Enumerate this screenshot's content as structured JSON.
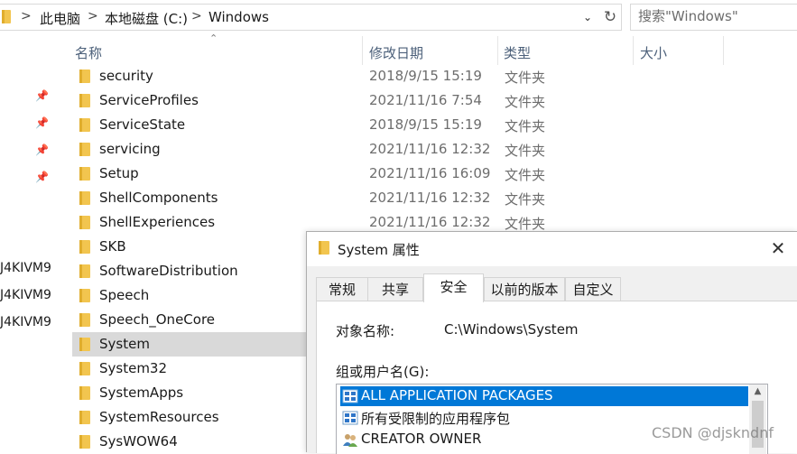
{
  "address": {
    "crumbs": [
      "此电脑",
      "本地磁盘 (C:)",
      "Windows"
    ],
    "separator": ">"
  },
  "search": {
    "placeholder": "搜索\"Windows\""
  },
  "columns": {
    "name": "名称",
    "date": "修改日期",
    "type": "类型",
    "size": "大小"
  },
  "nav": {
    "items": [
      "J4KIVM9",
      "J4KIVM9",
      "J4KIVM9"
    ]
  },
  "files": [
    {
      "name": "security",
      "date": "2018/9/15 15:19",
      "type": "文件夹"
    },
    {
      "name": "ServiceProfiles",
      "date": "2021/11/16 7:54",
      "type": "文件夹"
    },
    {
      "name": "ServiceState",
      "date": "2018/9/15 15:19",
      "type": "文件夹"
    },
    {
      "name": "servicing",
      "date": "2021/11/16 12:32",
      "type": "文件夹"
    },
    {
      "name": "Setup",
      "date": "2021/11/16 16:09",
      "type": "文件夹"
    },
    {
      "name": "ShellComponents",
      "date": "2021/11/16 12:32",
      "type": "文件夹"
    },
    {
      "name": "ShellExperiences",
      "date": "2021/11/16 12:32",
      "type": "文件夹"
    },
    {
      "name": "SKB",
      "date": "",
      "type": ""
    },
    {
      "name": "SoftwareDistribution",
      "date": "",
      "type": ""
    },
    {
      "name": "Speech",
      "date": "",
      "type": ""
    },
    {
      "name": "Speech_OneCore",
      "date": "",
      "type": ""
    },
    {
      "name": "System",
      "date": "",
      "type": "",
      "selected": true
    },
    {
      "name": "System32",
      "date": "",
      "type": ""
    },
    {
      "name": "SystemApps",
      "date": "",
      "type": ""
    },
    {
      "name": "SystemResources",
      "date": "",
      "type": ""
    },
    {
      "name": "SysWOW64",
      "date": "",
      "type": ""
    }
  ],
  "dialog": {
    "title": "System 属性",
    "close_symbol": "✕",
    "tabs": [
      "常规",
      "共享",
      "安全",
      "以前的版本",
      "自定义"
    ],
    "active_tab": "安全",
    "object_label": "对象名称:",
    "object_value": "C:\\Windows\\System",
    "group_label": "组或用户名(G):",
    "users": [
      {
        "name": "ALL APPLICATION PACKAGES",
        "selected": true
      },
      {
        "name": "所有受限制的应用程序包",
        "selected": false
      },
      {
        "name": "CREATOR OWNER",
        "selected": false
      }
    ]
  },
  "watermark": "CSDN @djskndnf",
  "colors": {
    "folder": "#f2c54f",
    "selection": "#0078d7",
    "row_selected": "#d9d9d9",
    "header_text": "#4c607a"
  }
}
